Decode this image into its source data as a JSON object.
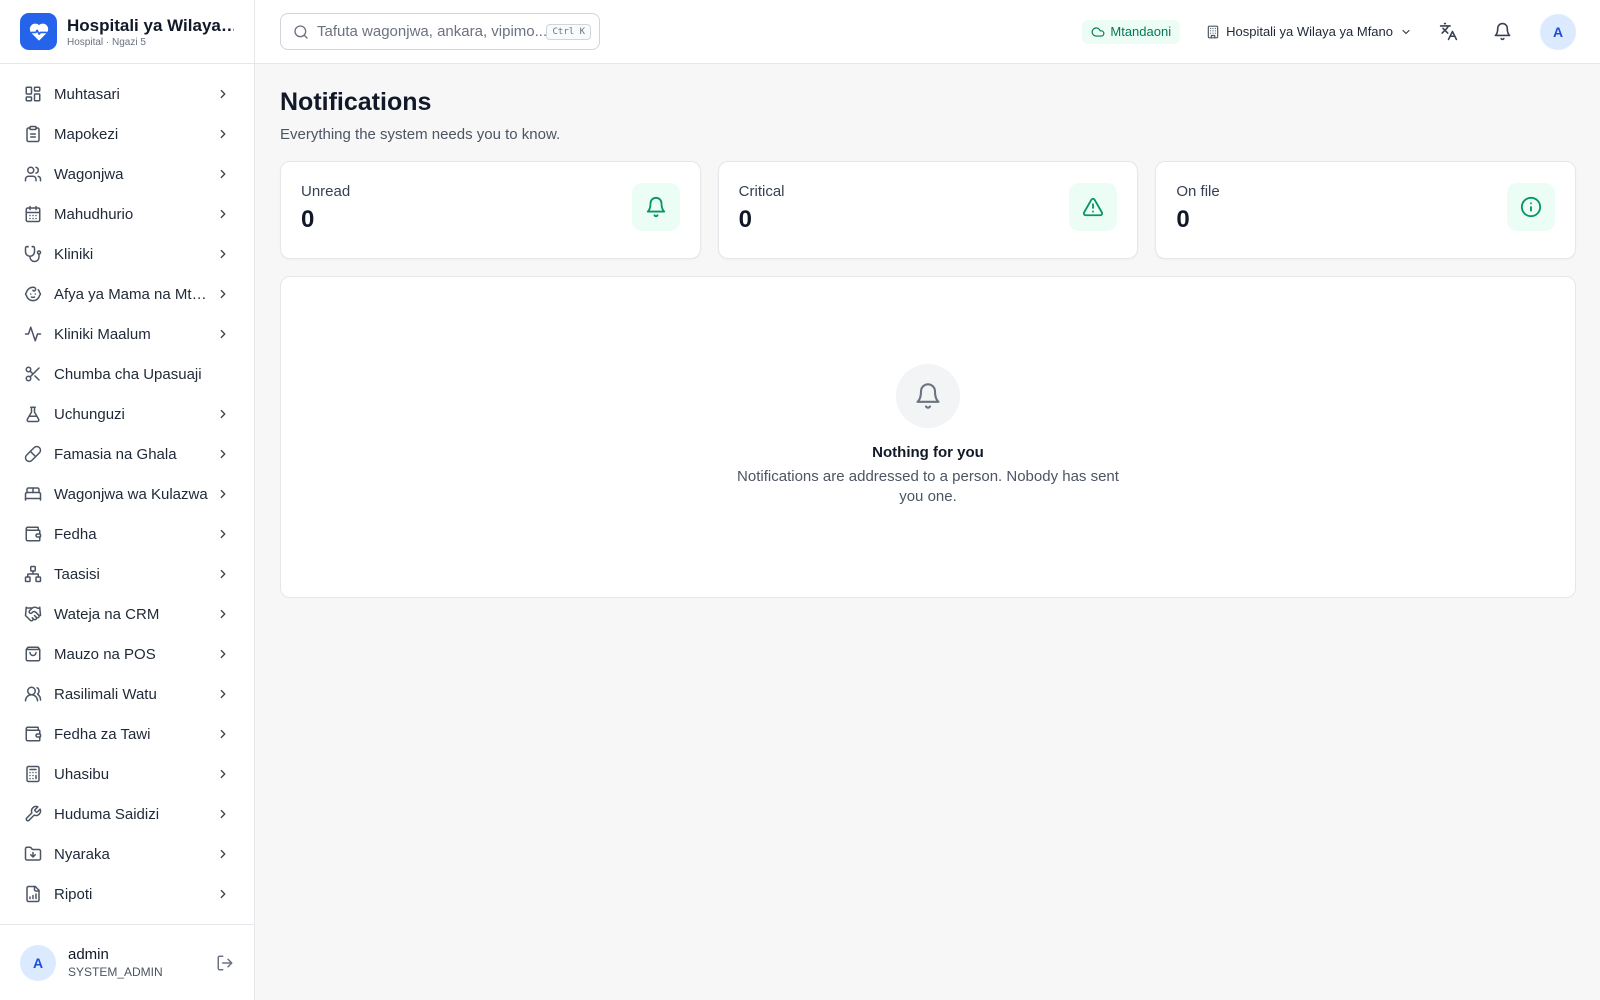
{
  "brand": {
    "title": "Hospitali ya Wilaya ya Mfano",
    "subtitle": "Hospital · Ngazi 5",
    "accent_color": "#2563eb"
  },
  "search": {
    "placeholder": "Tafuta wagonjwa, ankara, vipimo...",
    "value": "",
    "shortcut": "Ctrl K"
  },
  "header": {
    "status_label": "Mtandaoni",
    "facility_label": "Hospitali ya Wilaya ya Mfano",
    "avatar_initial": "A"
  },
  "sidebar": {
    "items": [
      {
        "label": "Muhtasari",
        "icon": "dashboard-icon",
        "chevron": true
      },
      {
        "label": "Mapokezi",
        "icon": "clipboard-icon",
        "chevron": true
      },
      {
        "label": "Wagonjwa",
        "icon": "users-icon",
        "chevron": true
      },
      {
        "label": "Mahudhurio",
        "icon": "calendar-icon",
        "chevron": true
      },
      {
        "label": "Kliniki",
        "icon": "stethoscope-icon",
        "chevron": true
      },
      {
        "label": "Afya ya Mama na Mtoto",
        "icon": "baby-icon",
        "chevron": true
      },
      {
        "label": "Kliniki Maalum",
        "icon": "activity-icon",
        "chevron": true
      },
      {
        "label": "Chumba cha Upasuaji",
        "icon": "scissors-icon",
        "chevron": false
      },
      {
        "label": "Uchunguzi",
        "icon": "flask-icon",
        "chevron": true
      },
      {
        "label": "Famasia na Ghala",
        "icon": "pill-icon",
        "chevron": true
      },
      {
        "label": "Wagonjwa wa Kulazwa",
        "icon": "bed-icon",
        "chevron": true
      },
      {
        "label": "Fedha",
        "icon": "wallet-icon",
        "chevron": true
      },
      {
        "label": "Taasisi",
        "icon": "network-icon",
        "chevron": true
      },
      {
        "label": "Wateja na CRM",
        "icon": "handshake-icon",
        "chevron": true
      },
      {
        "label": "Mauzo na POS",
        "icon": "shopping-bag-icon",
        "chevron": true
      },
      {
        "label": "Rasilimali Watu",
        "icon": "user-icon",
        "chevron": true
      },
      {
        "label": "Fedha za Tawi",
        "icon": "wallet-icon",
        "chevron": true
      },
      {
        "label": "Uhasibu",
        "icon": "calculator-icon",
        "chevron": true
      },
      {
        "label": "Huduma Saidizi",
        "icon": "wrench-icon",
        "chevron": true
      },
      {
        "label": "Nyaraka",
        "icon": "folder-icon",
        "chevron": true
      },
      {
        "label": "Ripoti",
        "icon": "report-icon",
        "chevron": true
      }
    ]
  },
  "user": {
    "initial": "A",
    "name": "admin",
    "role": "SYSTEM_ADMIN"
  },
  "page": {
    "title": "Notifications",
    "subtitle": "Everything the system needs you to know."
  },
  "stats": [
    {
      "label": "Unread",
      "value": "0",
      "icon": "bell-icon"
    },
    {
      "label": "Critical",
      "value": "0",
      "icon": "alert-triangle-icon"
    },
    {
      "label": "On file",
      "value": "0",
      "icon": "info-icon"
    }
  ],
  "empty_state": {
    "title": "Nothing for you",
    "text": "Notifications are addressed to a person. Nobody has sent you one."
  },
  "colors": {
    "success_bg": "#ecfdf5",
    "success": "#059669"
  }
}
